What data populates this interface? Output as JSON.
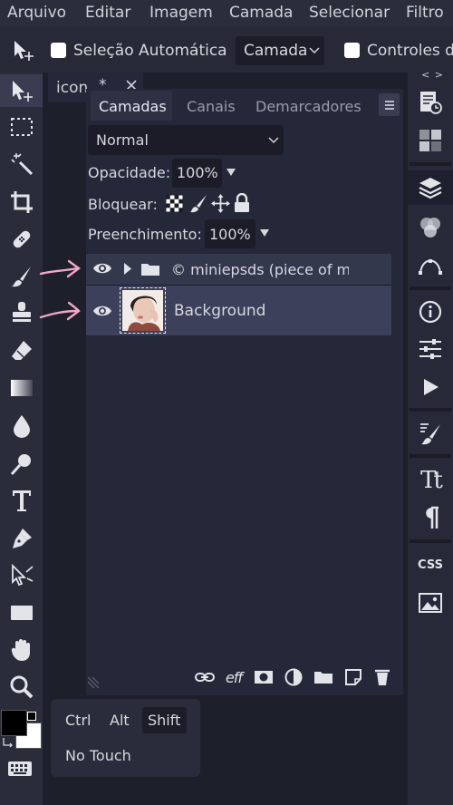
{
  "menu": {
    "items": [
      "Arquivo",
      "Editar",
      "Imagem",
      "Camada",
      "Selecionar",
      "Filtro"
    ]
  },
  "options": {
    "auto_select_label": "Seleção Automática",
    "auto_select_target": "Camada",
    "transform_controls_label": "Controles de"
  },
  "document": {
    "tab_title": "icon",
    "tab_modified_marker": "*"
  },
  "layers_panel": {
    "tabs": [
      "Camadas",
      "Canais",
      "Demarcadores"
    ],
    "active_tab": "Camadas",
    "collapse_glyph": "< >",
    "blend_mode": "Normal",
    "opacity_label": "Opacidade:",
    "opacity_value": "100%",
    "lock_label": "Bloquear:",
    "fill_label": "Preenchimento:",
    "fill_value": "100%",
    "layers": [
      {
        "type": "group",
        "name": "© miniepsds (piece of me",
        "visible": true
      },
      {
        "type": "image",
        "name": "Background",
        "visible": true
      }
    ],
    "footer_icons": [
      "link-icon",
      "effects-icon",
      "mask-icon",
      "adjustment-icon",
      "folder-icon",
      "new-layer-icon",
      "delete-icon"
    ],
    "effects_glyph": "eff"
  },
  "keyboard_popup": {
    "keys": [
      "Ctrl",
      "Alt",
      "Shift"
    ],
    "active_key": "Shift",
    "touch_label": "No Touch"
  },
  "right_panel": {
    "css_label": "CSS",
    "type_glyph": "Tt"
  },
  "colors": {
    "foreground": "#000000",
    "background": "#ffffff",
    "annotation_arrow": "#f3a6c8"
  }
}
